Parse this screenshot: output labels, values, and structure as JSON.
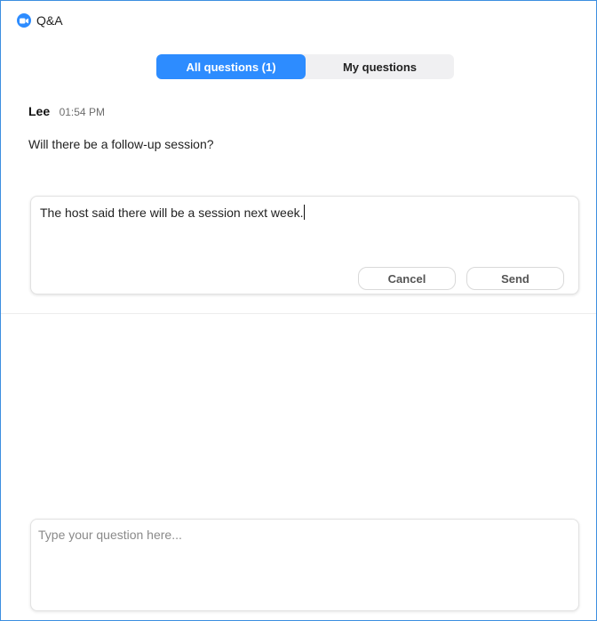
{
  "window": {
    "title": "Q&A",
    "icon": "zoom-camera-icon",
    "accent_color": "#2d8cff"
  },
  "tabs": [
    {
      "label": "All questions  (1)",
      "active": true
    },
    {
      "label": "My questions",
      "active": false
    }
  ],
  "question": {
    "author": "Lee",
    "time": "01:54 PM",
    "text": "Will there be a follow-up session?"
  },
  "reply": {
    "value": "The host said there will be a session next week.",
    "cancel_label": "Cancel",
    "send_label": "Send"
  },
  "compose": {
    "placeholder": "Type your question here..."
  }
}
